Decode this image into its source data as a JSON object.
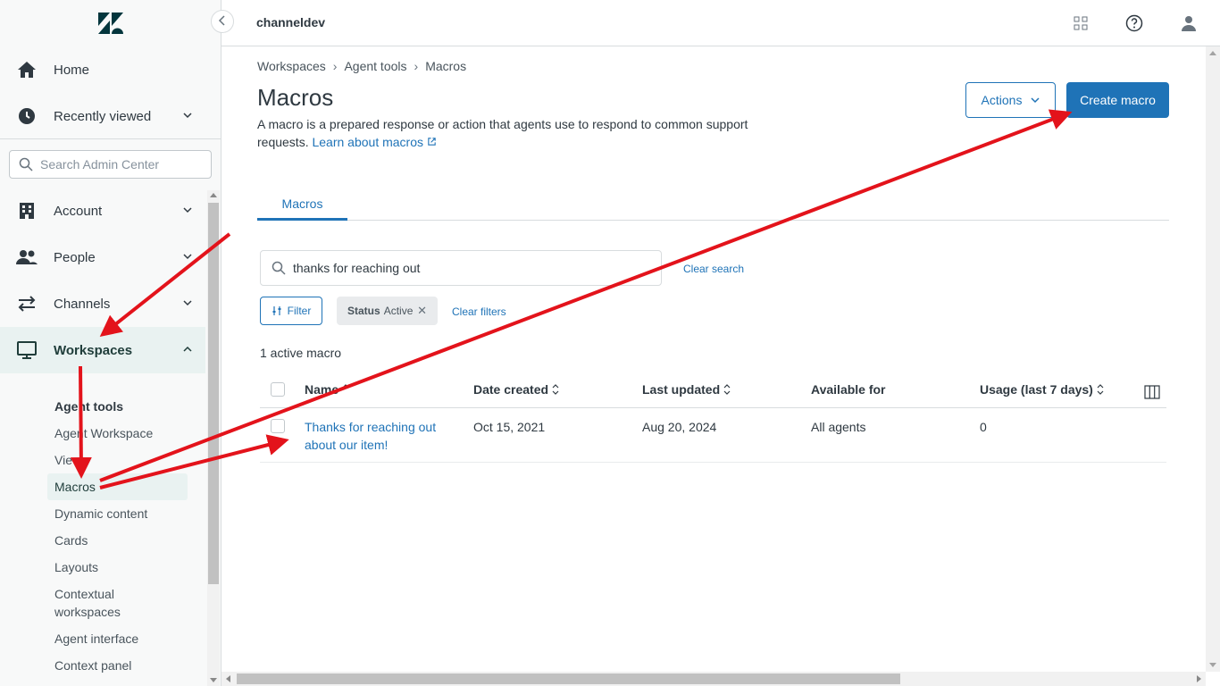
{
  "app": {
    "account_name": "channeldev"
  },
  "sidebar": {
    "nav": [
      {
        "label": "Home",
        "icon": "home-icon"
      },
      {
        "label": "Recently viewed",
        "icon": "clock-icon"
      },
      {
        "label": "Account",
        "icon": "building-icon"
      },
      {
        "label": "People",
        "icon": "people-icon"
      },
      {
        "label": "Channels",
        "icon": "arrows-icon"
      },
      {
        "label": "Workspaces",
        "icon": "monitor-icon"
      }
    ],
    "search_placeholder": "Search Admin Center",
    "sub_heading": "Agent tools",
    "sub_items": [
      "Agent Workspace",
      "Views",
      "Macros",
      "Dynamic content",
      "Cards",
      "Layouts",
      "Contextual workspaces",
      "Agent interface",
      "Context panel"
    ],
    "active_nav": "Workspaces",
    "active_sub": "Macros"
  },
  "breadcrumb": [
    "Workspaces",
    "Agent tools",
    "Macros"
  ],
  "page": {
    "title": "Macros",
    "description": "A macro is a prepared response or action that agents use to respond to common support requests.",
    "learn_link": "Learn about macros",
    "actions_label": "Actions",
    "create_label": "Create macro",
    "tab_label": "Macros"
  },
  "search": {
    "value": "thanks for reaching out",
    "clear_label": "Clear search"
  },
  "filters": {
    "filter_label": "Filter",
    "status_key": "Status",
    "status_value": "Active",
    "clear_label": "Clear filters"
  },
  "result_count": "1 active macro",
  "table": {
    "columns": [
      "Name",
      "Date created",
      "Last updated",
      "Available for",
      "Usage (last 7 days)"
    ],
    "rows": [
      {
        "name": "Thanks for reaching out about our item!",
        "created": "Oct 15, 2021",
        "updated": "Aug 20, 2024",
        "available": "All agents",
        "usage": "0"
      }
    ]
  },
  "colors": {
    "accent": "#1f73b7",
    "sidebar_bg": "#f8f9f9",
    "active_bg": "#e9f2f1",
    "annotation_red": "#e3131b"
  }
}
